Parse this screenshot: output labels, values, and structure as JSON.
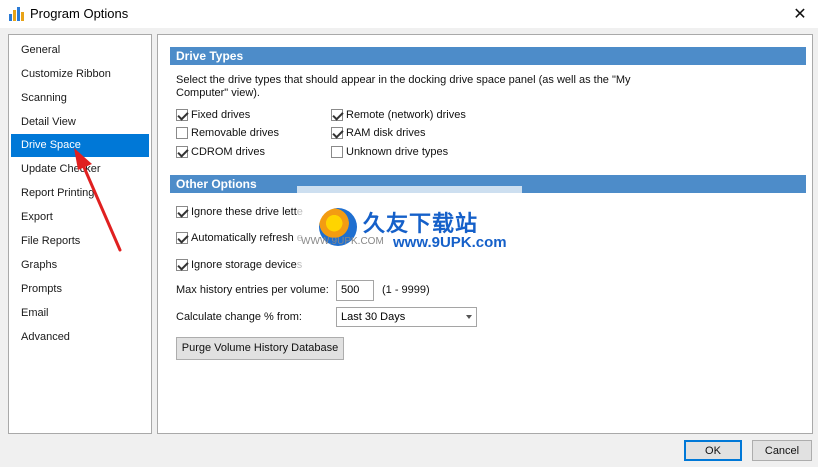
{
  "window": {
    "title": "Program Options",
    "close_glyph": "✕"
  },
  "nav": {
    "items": [
      {
        "label": "General"
      },
      {
        "label": "Customize Ribbon"
      },
      {
        "label": "Scanning"
      },
      {
        "label": "Detail View"
      },
      {
        "label": "Drive Space",
        "selected": true
      },
      {
        "label": "Update Checker"
      },
      {
        "label": "Report Printing"
      },
      {
        "label": "Export"
      },
      {
        "label": "File Reports"
      },
      {
        "label": "Graphs"
      },
      {
        "label": "Prompts"
      },
      {
        "label": "Email"
      },
      {
        "label": "Advanced"
      }
    ]
  },
  "drive_types": {
    "header": "Drive Types",
    "description": "Select the drive types that should appear in the docking drive space panel (as well as the \"My Computer\" view).",
    "options": [
      {
        "label": "Fixed drives",
        "checked": true
      },
      {
        "label": "Removable drives",
        "checked": false
      },
      {
        "label": "CDROM drives",
        "checked": true
      },
      {
        "label": "Remote (network) drives",
        "checked": true
      },
      {
        "label": "RAM disk drives",
        "checked": true
      },
      {
        "label": "Unknown drive types",
        "checked": false
      }
    ]
  },
  "other_options": {
    "header": "Other Options",
    "ignore_letters_label": "Ignore these drive lette",
    "ignore_letters_checked": true,
    "auto_refresh_label": "Automatically refresh e",
    "auto_refresh_checked": true,
    "ignore_storage_label": "Ignore storage devices",
    "ignore_storage_checked": true,
    "max_history_label": "Max history entries per volume:",
    "max_history_value": "500",
    "max_history_range": "(1 - 9999)",
    "calc_change_label": "Calculate change % from:",
    "calc_change_value": "Last 30 Days",
    "purge_button": "Purge Volume History Database"
  },
  "footer": {
    "ok_label": "OK",
    "cancel_label": "Cancel"
  },
  "watermark": {
    "cn_text": "久友下载站",
    "url_text": "www.9UPK.com",
    "small_text": "WWW.9UPK.COM"
  },
  "colors": {
    "accent": "#0078d7",
    "section_header": "#4d8cc9",
    "annotation_arrow": "#e02020"
  }
}
